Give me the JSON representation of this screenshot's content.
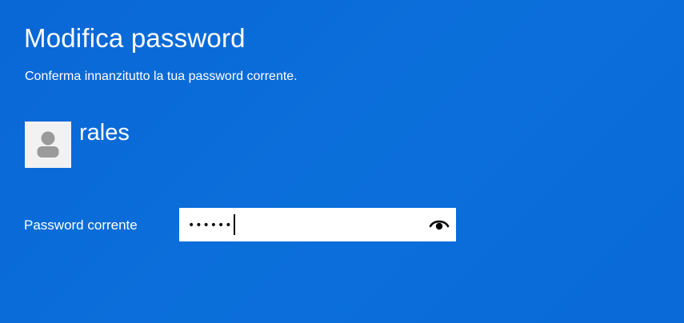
{
  "header": {
    "title": "Modifica password",
    "subtitle": "Conferma innanzitutto la tua password corrente."
  },
  "user": {
    "name": "rales",
    "avatar_icon": "user-silhouette-icon"
  },
  "password_field": {
    "label": "Password corrente",
    "masked_value": "••••••",
    "reveal_icon": "eye-icon"
  },
  "colors": {
    "background": "#0b6fda",
    "text": "#ffffff",
    "avatar_bg": "#f2f2f2",
    "avatar_fg": "#9a9a9a"
  }
}
